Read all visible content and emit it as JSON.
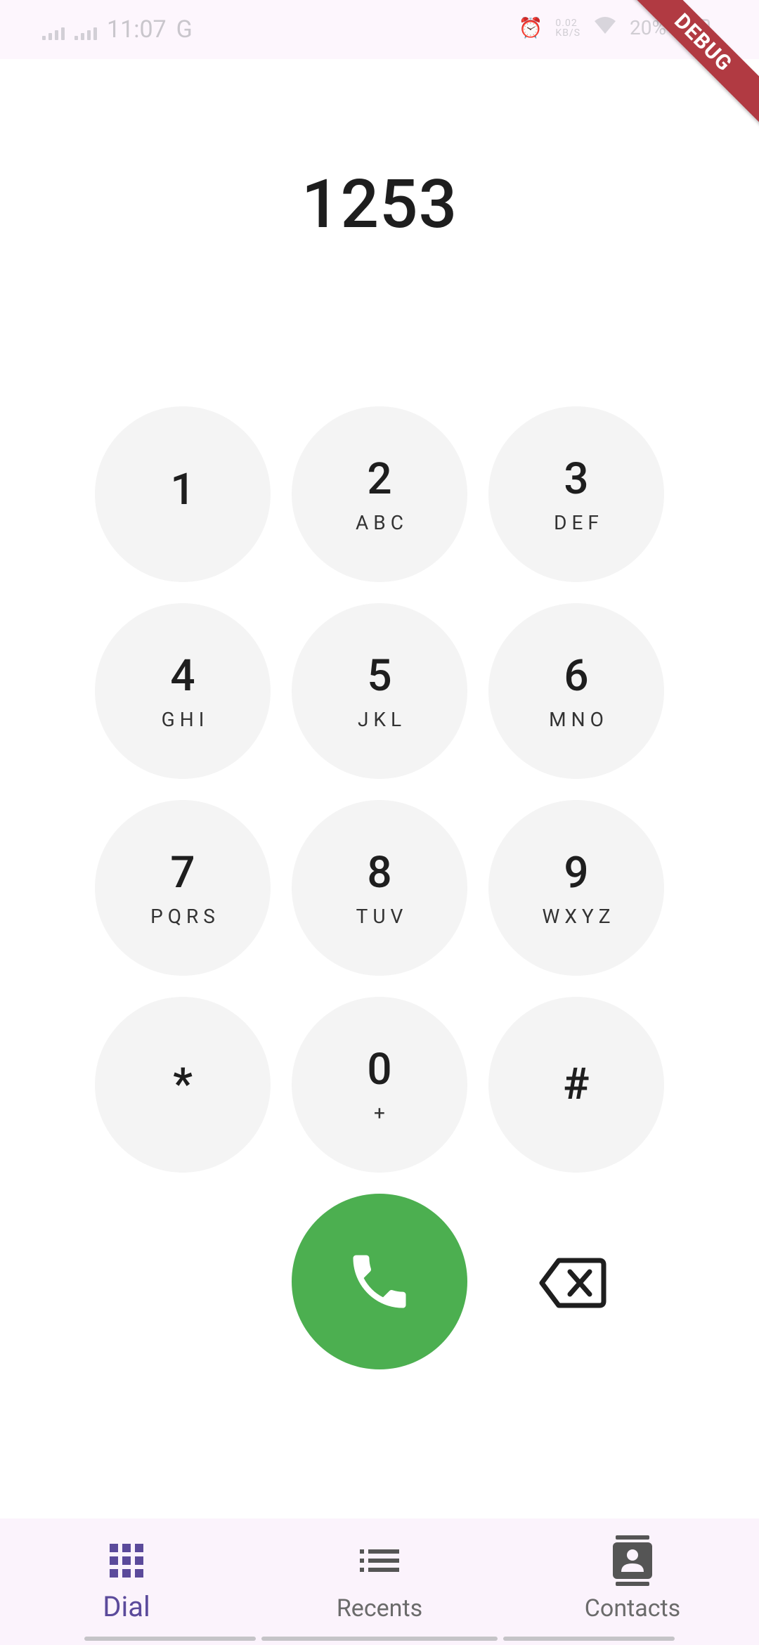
{
  "status_bar": {
    "time": "11:07",
    "battery": "20%",
    "net_speed_top": "0.02",
    "net_speed_bottom": "KB/S"
  },
  "debug_banner": "DEBUG",
  "dialer": {
    "number": "1253"
  },
  "keypad": [
    {
      "digit": "1",
      "letters": ""
    },
    {
      "digit": "2",
      "letters": "ABC"
    },
    {
      "digit": "3",
      "letters": "DEF"
    },
    {
      "digit": "4",
      "letters": "GHI"
    },
    {
      "digit": "5",
      "letters": "JKL"
    },
    {
      "digit": "6",
      "letters": "MNO"
    },
    {
      "digit": "7",
      "letters": "PQRS"
    },
    {
      "digit": "8",
      "letters": "TUV"
    },
    {
      "digit": "9",
      "letters": "WXYZ"
    },
    {
      "digit": "*",
      "letters": ""
    },
    {
      "digit": "0",
      "letters": "+"
    },
    {
      "digit": "#",
      "letters": ""
    }
  ],
  "colors": {
    "call": "#4caf50",
    "active_tab": "#5b4a9b",
    "key_background": "#f4f4f4"
  },
  "nav": {
    "items": [
      {
        "label": "Dial",
        "icon": "dialpad-icon",
        "active": true
      },
      {
        "label": "Recents",
        "icon": "list-icon",
        "active": false
      },
      {
        "label": "Contacts",
        "icon": "contacts-icon",
        "active": false
      }
    ]
  }
}
